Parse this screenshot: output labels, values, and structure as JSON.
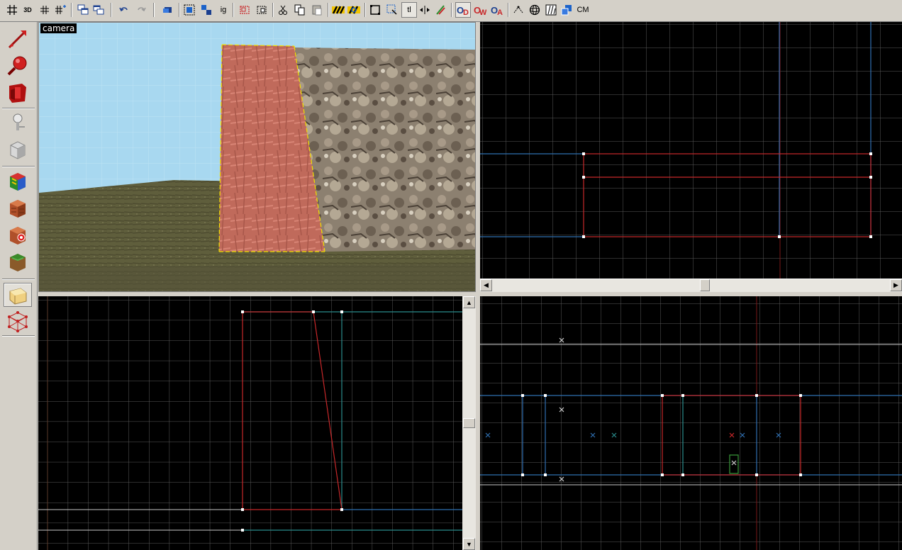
{
  "toolbar": {
    "grid_3d_label": "3D",
    "cut_label": "ig",
    "texlock_label": "tl",
    "cm_label": "CM"
  },
  "camera_view": {
    "label": "camera"
  },
  "icons": [
    "grid-icon",
    "3d-grid-icon",
    "grid-smaller-icon",
    "grid-larger-icon",
    "load-window-state-icon",
    "save-window-state-icon",
    "undo-icon",
    "redo-icon",
    "cordon-icon",
    "group-icon",
    "ungroup-icon",
    "ignore-groups-icon",
    "hide-selected-icon",
    "hide-unselected-icon",
    "cut-icon",
    "copy-icon",
    "paste-icon",
    "hazard-stripes-icon",
    "carve-icon",
    "selection-box-icon",
    "select-transparent-icon",
    "texture-lock-icon",
    "flip-icon",
    "paint-icon",
    "show-helpers-icon",
    "toggle-model-icon",
    "toggle-displacement-icon",
    "vertex-icon",
    "sphere-icon",
    "texture-grid-icon",
    "cube-select-icon"
  ],
  "palette_tools": [
    "selection-tool-icon",
    "magnify-tool-icon",
    "camera-tool-icon",
    "entity-tool-icon",
    "block-tool-icon",
    "toggle-texture-application-icon",
    "apply-current-texture-icon",
    "decal-tool-icon",
    "overlay-tool-icon",
    "clipping-tool-icon",
    "vertex-manipulation-tool-icon"
  ],
  "colors": {
    "selection_red": "#c8282a",
    "brush_blue": "#2f6fb0",
    "grid_line": "#5a5a5a",
    "teal_outline": "#2a8c8c",
    "sky": "#a8d8f0",
    "ground": "#5f5e3c"
  }
}
